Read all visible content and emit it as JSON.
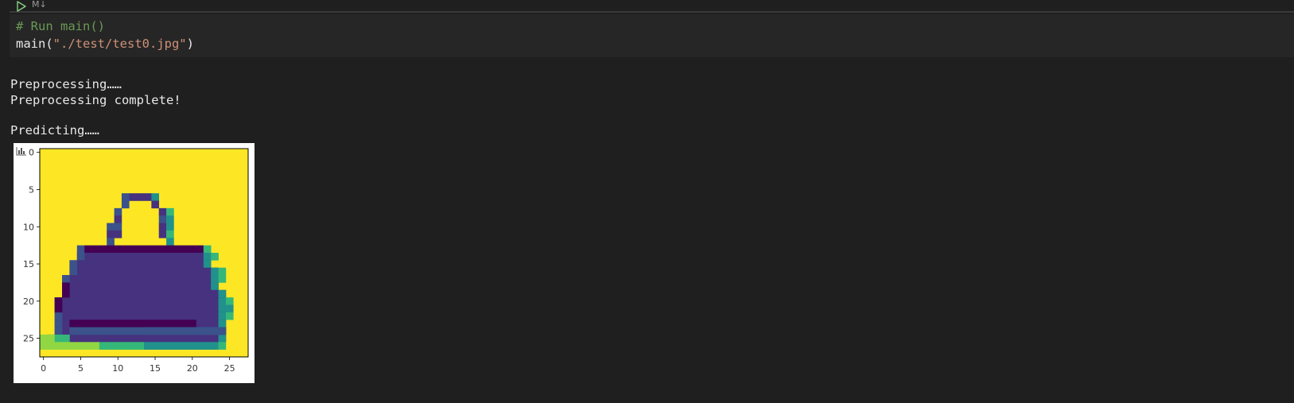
{
  "toolbar": {
    "run_icon": "run-triangle-icon",
    "markdown_label": "M↓"
  },
  "code": {
    "comment": "# Run main()",
    "call_prefix": "main(",
    "call_arg": "\"./test/test0.jpg\"",
    "call_suffix": ")"
  },
  "output": {
    "lines": [
      "Preprocessing……",
      "Preprocessing complete!",
      "",
      "Predicting……"
    ]
  },
  "plot": {
    "icon": "chart-icon",
    "x_ticks": [
      "0",
      "5",
      "10",
      "15",
      "20",
      "25"
    ],
    "y_ticks": [
      "0",
      "5",
      "10",
      "15",
      "20",
      "25"
    ],
    "colors": {
      "background": "#fde725",
      "dark": "#440154",
      "purple": "#46327e",
      "blue": "#3b528b",
      "teal": "#21918c",
      "green": "#35b779",
      "lime": "#90d743"
    }
  }
}
